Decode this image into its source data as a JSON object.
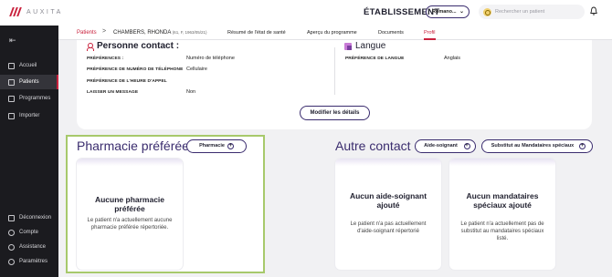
{
  "app": {
    "logo_text": "AUXITA"
  },
  "header": {
    "title": "ÉTABLISSEMENT",
    "selector_value": "Romano...",
    "search_placeholder": "Rechercher un patient"
  },
  "sidebar": {
    "items": [
      {
        "label": "Accueil"
      },
      {
        "label": "Patients"
      },
      {
        "label": "Programmes"
      },
      {
        "label": "Importer"
      },
      {
        "label": "Déconnexion"
      },
      {
        "label": "Compte"
      },
      {
        "label": "Assistance"
      },
      {
        "label": "Paramètres"
      }
    ]
  },
  "breadcrumb": {
    "link": "Patients",
    "separator": ">",
    "patient_name": "CHAMBERS, RHONDA",
    "patient_meta": "(61, F, 1963/05/21)"
  },
  "tabs": [
    {
      "label": "Résumé de l'état de santé"
    },
    {
      "label": "Aperçu du programme"
    },
    {
      "label": "Documents"
    },
    {
      "label": "Profil"
    }
  ],
  "contact": {
    "title": "Personne contact :",
    "fields": [
      {
        "label": "PRÉFÉRENCES :",
        "value": "Numéro de téléphone"
      },
      {
        "label": "PRÉFÉRENCE DE NUMÉRO DE TÉLÉPHONE",
        "value": "Cellulaire"
      },
      {
        "label": "PRÉFÉRENCE DE L'HEURE D'APPEL",
        "value": ""
      },
      {
        "label": "LAISSER UN MESSAGE",
        "value": "Non"
      }
    ]
  },
  "language": {
    "title": "Langue",
    "field_label": "PRÉFÉRENCE DE LANGUE",
    "field_value": "Anglais"
  },
  "edit_button": "Modifier les détails",
  "pharmacy": {
    "title": "Pharmacie préférée",
    "button": "Pharmacie",
    "empty_title": "Aucune pharmacie préférée",
    "empty_desc": "Le patient n'a actuellement aucune pharmacie préférée répertoriée."
  },
  "other_contact": {
    "title": "Autre contact",
    "caregiver_button": "Aide-soignant",
    "substitute_button": "Substitut au Mandataires spéciaux",
    "caregiver_empty_title": "Aucun aide-soignant ajouté",
    "caregiver_empty_desc": "Le patient n'a pas actuellement d'aide-soignant répertorié",
    "substitute_empty_title": "Aucun mandataires spéciaux ajouté",
    "substitute_empty_desc": "Le patient n'a actuellement pas de substitut au mandataires spéciaux listé."
  },
  "colors": {
    "accent": "#c9213d",
    "primary": "#3a2c6e",
    "highlight_border": "#a7c96b",
    "sidebar_bg": "#1b1b1f"
  }
}
